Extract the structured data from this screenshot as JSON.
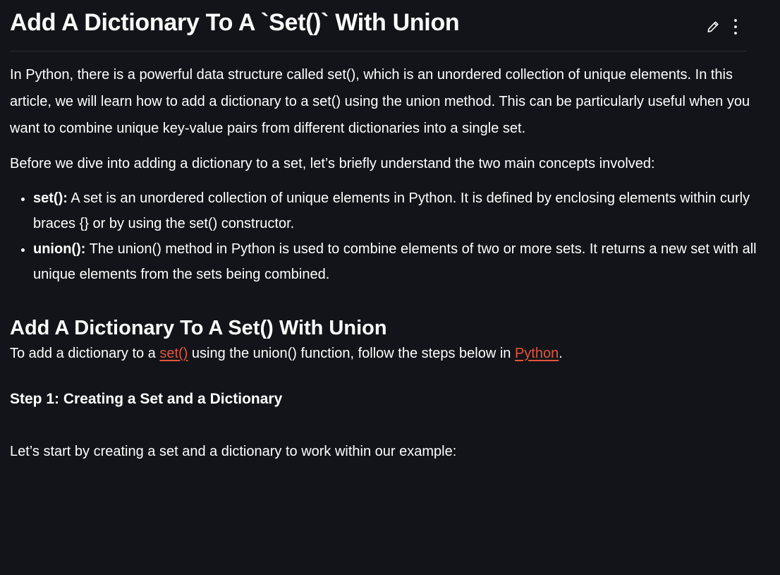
{
  "article": {
    "title": "Add A Dictionary To A `Set()` With Union",
    "intro_1": "In Python, there is a powerful data structure called set(), which is an unordered collection of unique elements. In this article, we will learn how to add a dictionary to a set() using the union method. This can be particularly useful when you want to combine unique key-value pairs from different dictionaries into a single set.",
    "intro_2": "Before we dive into adding a dictionary to a set, let’s briefly understand the two main concepts involved:",
    "concepts": [
      {
        "term": "set():",
        "desc": " A set is an unordered collection of unique elements in Python. It is defined by enclosing elements within curly braces {} or by using the set() constructor."
      },
      {
        "term": "union():",
        "desc": " The union() method in Python is used to combine elements of two or more sets. It returns a new set with all unique elements from the sets being combined."
      }
    ],
    "section_heading": "Add A Dictionary To A Set() With Union",
    "section_text_before": "To add a dictionary to a ",
    "link_set": "set()",
    "section_text_middle": " using the union() function, follow the steps below in ",
    "link_python": "Python",
    "section_text_after": ".",
    "step_heading": "Step 1: Creating a Set and a Dictionary",
    "step_text": "Let’s start by creating a set and a dictionary to work within our example:"
  },
  "actions": {
    "edit_icon": "pencil-icon",
    "more_icon": "more-vertical-icon"
  },
  "colors": {
    "background": "#131419",
    "text": "#ffffff",
    "link": "#e2553a"
  }
}
